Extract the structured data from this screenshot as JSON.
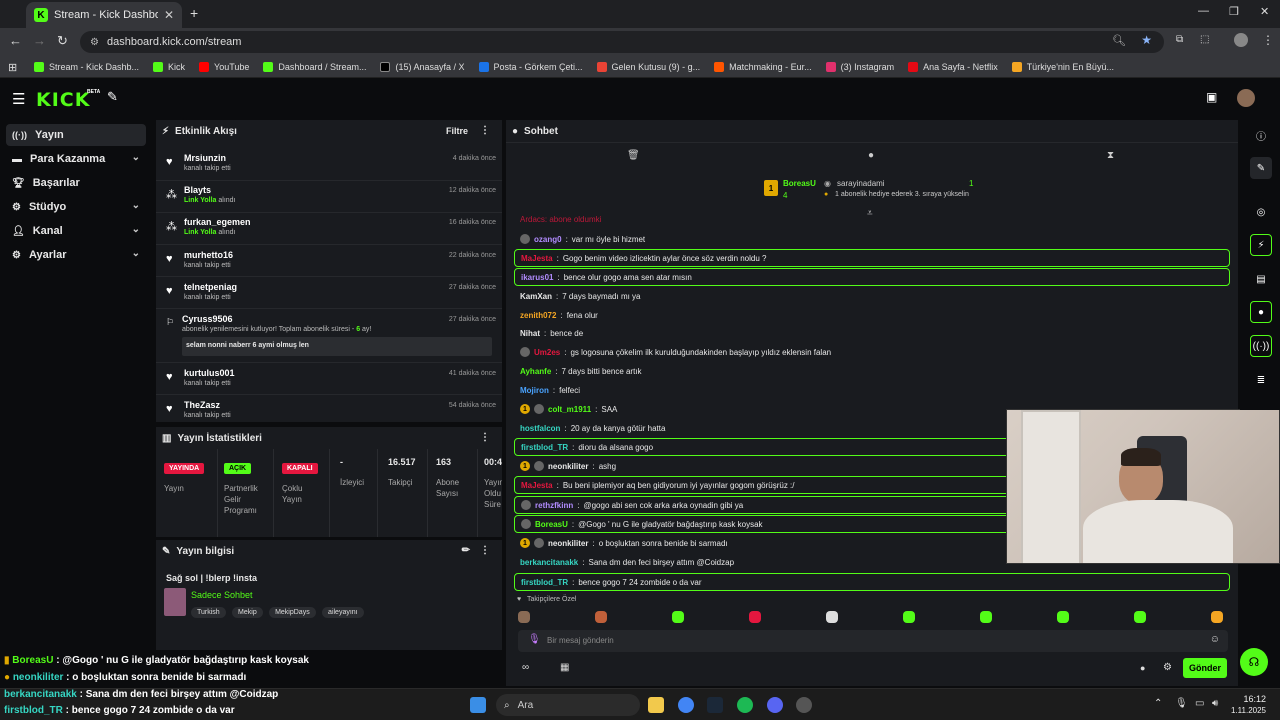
{
  "browser": {
    "tab_title": "Stream - Kick Dashboard",
    "url": "dashboard.kick.com/stream",
    "bookmarks": [
      {
        "label": "Stream - Kick Dashb...",
        "color": "#53fc18"
      },
      {
        "label": "Kick",
        "color": "#53fc18"
      },
      {
        "label": "YouTube",
        "color": "#ff0000"
      },
      {
        "label": "Dashboard / Stream...",
        "color": "#53fc18"
      },
      {
        "label": "(15) Anasayfa / X",
        "color": "#000000"
      },
      {
        "label": "Posta - Görkem Çeti...",
        "color": "#1a73e8"
      },
      {
        "label": "Gelen Kutusu (9) - g...",
        "color": "#ea4335"
      },
      {
        "label": "Matchmaking - Eur...",
        "color": "#ff5500"
      },
      {
        "label": "(3) Instagram",
        "color": "#e1306c"
      },
      {
        "label": "Ana Sayfa - Netflix",
        "color": "#e50914"
      },
      {
        "label": "Türkiye'nin En Büyü...",
        "color": "#f5a623"
      }
    ]
  },
  "app": {
    "logo": "KICK",
    "logo_beta": "BETA"
  },
  "sidebar": {
    "items": [
      {
        "label": "Yayın",
        "icon": "broadcast-icon"
      },
      {
        "label": "Para Kazanma",
        "icon": "money-icon"
      },
      {
        "label": "Başarılar",
        "icon": "trophy-icon"
      },
      {
        "label": "Stüdyo",
        "icon": "studio-icon"
      },
      {
        "label": "Kanal",
        "icon": "user-icon"
      },
      {
        "label": "Ayarlar",
        "icon": "gear-icon"
      }
    ]
  },
  "activity": {
    "title": "Etkinlik Akışı",
    "filter": "Filtre",
    "events": [
      {
        "name": "Mrsiunzin",
        "sub": "kanalı takip etti",
        "time": "4 dakika önce",
        "hl": ""
      },
      {
        "name": "Blayts",
        "sub": "alındı",
        "hl": "Link Yolla",
        "time": "12 dakika önce"
      },
      {
        "name": "furkan_egemen",
        "sub": "alındı",
        "hl": "Link Yolla",
        "time": "16 dakika önce"
      },
      {
        "name": "murhetto16",
        "sub": "kanalı takip etti",
        "time": "22 dakika önce",
        "hl": ""
      },
      {
        "name": "telnetpeniag",
        "sub": "kanalı takip etti",
        "time": "27 dakika önce",
        "hl": ""
      },
      {
        "name": "Cyruss9506",
        "sub": "abonelik yenilemesini kutluyor! Toplam abonelik süresi - ",
        "hl": "6",
        "sub2": " ay!",
        "time": "27 dakika önce",
        "note": "selam nonni naberr 6 aymi olmuş len"
      },
      {
        "name": "kurtulus001",
        "sub": "kanalı takip etti",
        "time": "41 dakika önce",
        "hl": ""
      },
      {
        "name": "TheZasz",
        "sub": "kanalı takip etti",
        "time": "54 dakika önce",
        "hl": ""
      }
    ]
  },
  "stats": {
    "title": "Yayın İstatistikleri",
    "cols": [
      {
        "badge": "YAYINDA",
        "label": "Yayın",
        "color": "#e5173f",
        "fg": "#ffffff"
      },
      {
        "badge": "AÇIK",
        "label": "Partnerlik Gelir Programı",
        "color": "#53fc18",
        "fg": "#000000"
      },
      {
        "badge": "KAPALI",
        "label": "Çoklu Yayın",
        "color": "#e5173f",
        "fg": "#ffffff"
      },
      {
        "value": "-",
        "label": "İzleyici"
      },
      {
        "value": "16.517",
        "label": "Takipçi"
      },
      {
        "value": "163",
        "label": "Abone Sayısı"
      },
      {
        "value": "00:4",
        "label": "Yayın Oldu Süre"
      }
    ]
  },
  "stream_info": {
    "title": "Yayın bilgisi",
    "stream_title": "Sağ sol | !blerp !insta",
    "category": "Sadece Sohbet",
    "tags": [
      "Turkish",
      "Mekip",
      "MekipDays",
      "aileyayını"
    ]
  },
  "chat": {
    "title": "Sohbet",
    "pinned": {
      "user1": "BoreasU",
      "user1_count": "4",
      "user2": "sarayinadami",
      "user2_count": "1",
      "desc": "1 abonelik hediye ederek 3. sıraya yükselin"
    },
    "partial_top": "Ardacs: abone oldumki",
    "messages": [
      {
        "user": "ozang0",
        "text": "var mı öyle bi hizmet",
        "color": "#b28cff",
        "hl": false,
        "av": true,
        "lvl": ""
      },
      {
        "user": "MaJesta",
        "text": "Gogo benim video izlicektin aylar önce söz verdin noldu ?",
        "color": "#e5173f",
        "hl": true,
        "av": false,
        "lvl": ""
      },
      {
        "user": "ikarus01",
        "text": "bence olur gogo ama sen atar mısın",
        "color": "#b28cff",
        "hl": true,
        "av": false,
        "lvl": ""
      },
      {
        "user": "KamXan",
        "text": "7 days baymadı mı ya",
        "color": "#e8e8e8",
        "hl": false,
        "av": false,
        "lvl": ""
      },
      {
        "user": "zenith072",
        "text": "fena olur",
        "color": "#f5a623",
        "hl": false,
        "av": false,
        "lvl": ""
      },
      {
        "user": "Nihat",
        "text": "bence de",
        "color": "#e8e8e8",
        "hl": false,
        "av": false,
        "lvl": ""
      },
      {
        "user": "Um2es",
        "text": "gs logosuna çökelim ilk kurulduğundakinden başlayıp yıldız eklensin falan",
        "color": "#e5173f",
        "hl": false,
        "av": true,
        "lvl": ""
      },
      {
        "user": "Ayhanfe",
        "text": "7 days bitti bence artık",
        "color": "#53fc18",
        "hl": false,
        "av": false,
        "lvl": ""
      },
      {
        "user": "Mojiron",
        "text": "felfeci",
        "color": "#4aa3ff",
        "hl": false,
        "av": false,
        "lvl": ""
      },
      {
        "user": "colt_m1911",
        "text": "SAA",
        "color": "#53fc18",
        "hl": false,
        "av": true,
        "lvl": "1"
      },
      {
        "user": "hostfalcon",
        "text": "20 ay da kanya götür hatta",
        "color": "#36d6c3",
        "hl": false,
        "av": false,
        "lvl": ""
      },
      {
        "user": "firstblod_TR",
        "text": "dioru da alsana gogo",
        "color": "#36d6c3",
        "hl": true,
        "av": false,
        "lvl": ""
      },
      {
        "user": "neonkiliter",
        "text": "ashg",
        "color": "#e8e8e8",
        "hl": false,
        "av": true,
        "lvl": "1"
      },
      {
        "user": "MaJesta",
        "text": "Bu beni iplemiyor aq ben gidiyorum iyi yayınlar gogom görüşrüz :/",
        "color": "#e5173f",
        "hl": true,
        "av": false,
        "lvl": ""
      },
      {
        "user": "rethzfkinn",
        "text": "@gogo abi sen cok arka arka oynadin gibi ya",
        "color": "#b28cff",
        "hl": true,
        "av": true,
        "lvl": ""
      },
      {
        "user": "BoreasU",
        "text": "@Gogo ' nu G ile gladyatör bağdaştırıp kask koysak",
        "color": "#53fc18",
        "hl": true,
        "av": true,
        "lvl": ""
      },
      {
        "user": "neonkiliter",
        "text": "o boşluktan sonra benide bi sarmadı",
        "color": "#e8e8e8",
        "hl": false,
        "av": true,
        "lvl": "1"
      },
      {
        "user": "berkancitanakk",
        "text": "Sana dm den feci birşey attım @Coidzap",
        "color": "#36d6c3",
        "hl": false,
        "av": false,
        "lvl": ""
      },
      {
        "user": "firstblod_TR",
        "text": "bence gogo 7 24 zombide o da var",
        "color": "#36d6c3",
        "hl": true,
        "av": false,
        "lvl": ""
      }
    ],
    "emote_label": "Takipçilere Özel",
    "input_placeholder": "Bir mesaj gönderin",
    "send": "Gönder"
  },
  "overlay_chat": [
    {
      "user": "BoreasU",
      "text": " : @Gogo ' nu G ile gladyatör bağdaştırıp kask koysak",
      "color": "#53fc18"
    },
    {
      "user": "neonkiliter",
      "text": " : o boşluktan sonra benide bi sarmadı",
      "color": "#36d6c3"
    },
    {
      "user": "berkancitanakk",
      "text": " : Sana dm den feci birşey attım @Coidzap",
      "color": "#36d6c3"
    },
    {
      "user": "firstblod_TR",
      "text": " : bence gogo 7 24 zombide o da var",
      "color": "#36d6c3"
    }
  ],
  "taskbar": {
    "search": "Ara",
    "time": "16:12",
    "date": "1.11.2025"
  },
  "colors": {
    "accent": "#53fc18",
    "live": "#e5173f"
  }
}
